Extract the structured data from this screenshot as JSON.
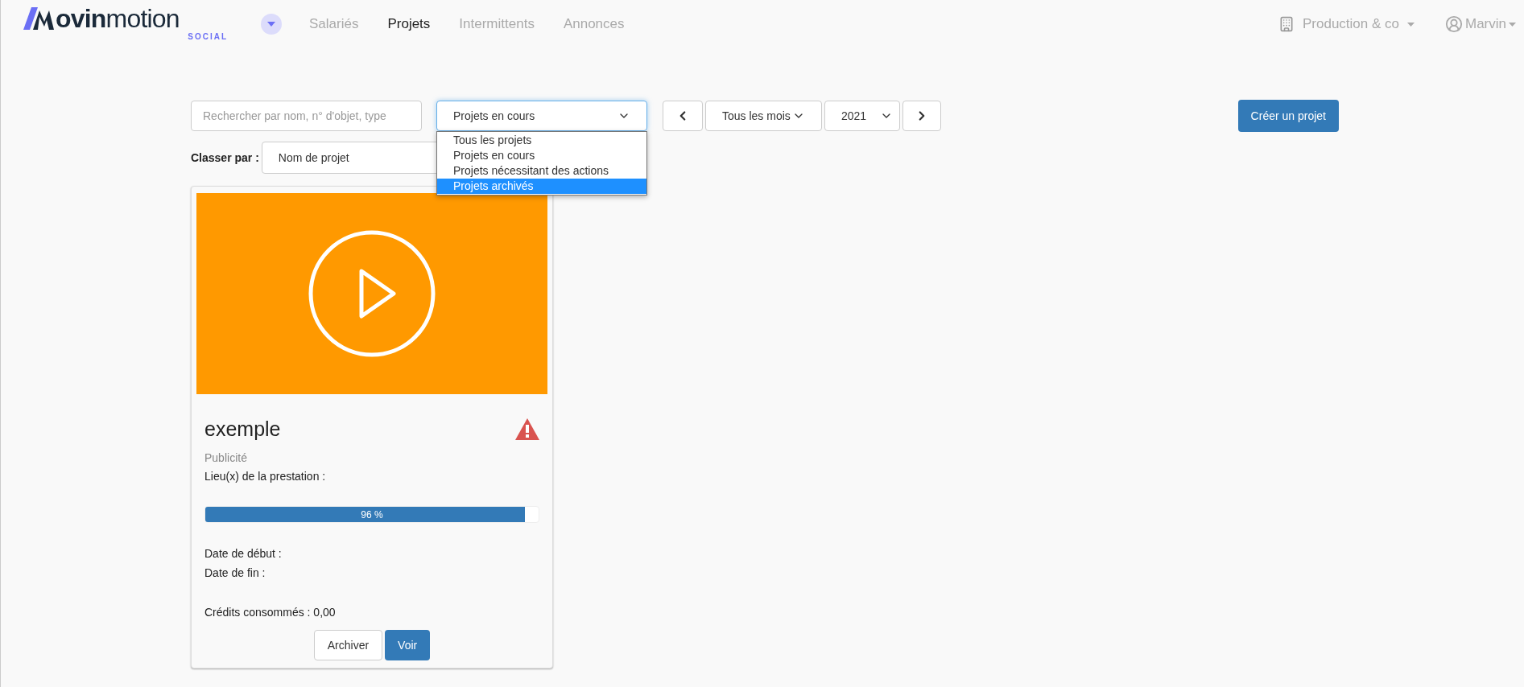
{
  "logo": {
    "bold": "ovin",
    "light": "motion",
    "sub": "SOCIAL"
  },
  "nav": [
    {
      "label": "Salariés",
      "selected": false
    },
    {
      "label": "Projets",
      "selected": true
    },
    {
      "label": "Intermittents",
      "selected": false
    },
    {
      "label": "Annonces",
      "selected": false
    }
  ],
  "company": "Production & co",
  "user": "Marvin",
  "search": {
    "placeholder": "Rechercher par nom, n° d'objet, type"
  },
  "filter": {
    "value": "Projets en cours",
    "expanded": true,
    "options": [
      {
        "label": "Tous les projets",
        "highlighted": false
      },
      {
        "label": "Projets en cours",
        "highlighted": false
      },
      {
        "label": "Projets nécessitant des actions",
        "highlighted": false
      },
      {
        "label": "Projets archivés",
        "highlighted": true
      }
    ]
  },
  "month": "Tous les mois",
  "year": "2021",
  "create_button": "Créer un projet",
  "sort": {
    "label": "Classer par :",
    "value": "Nom de projet"
  },
  "cards": [
    {
      "title": "exemple",
      "warning": true,
      "type": "Publicité",
      "place": "Lieu(x) de la prestation :",
      "level": 0.96,
      "progress_label": "96 %",
      "start": "Date de début :",
      "end": "Date de fin :",
      "credits": "Crédits consommés : 0,00",
      "buttons": [
        "Archiver",
        "Voir"
      ]
    }
  ]
}
